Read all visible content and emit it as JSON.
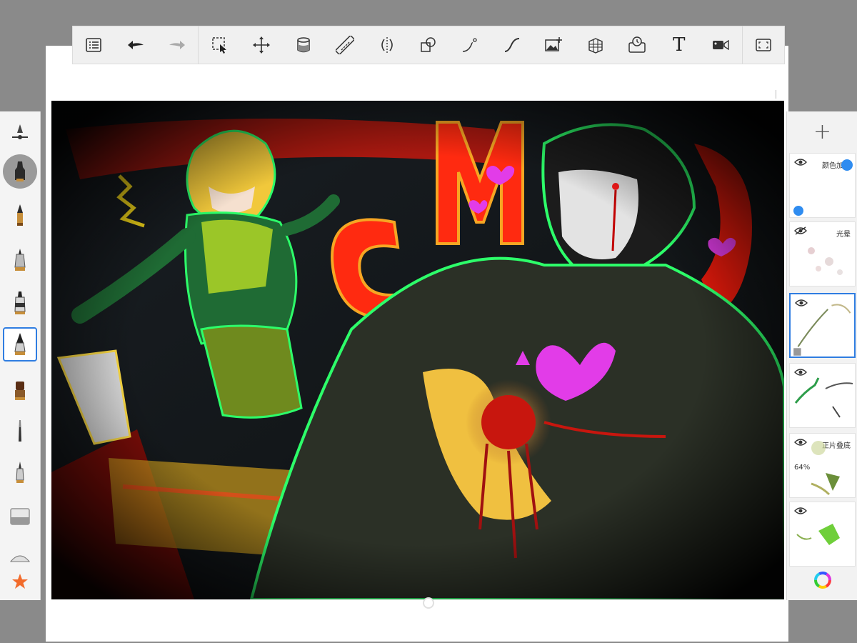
{
  "toolbar": {
    "tools": [
      {
        "name": "list-icon",
        "label": ""
      },
      {
        "name": "undo-icon",
        "label": ""
      },
      {
        "name": "redo-icon",
        "label": ""
      },
      {
        "name": "selection-icon",
        "label": ""
      },
      {
        "name": "transform-icon",
        "label": ""
      },
      {
        "name": "fill-icon",
        "label": ""
      },
      {
        "name": "ruler-icon",
        "label": ""
      },
      {
        "name": "symmetry-icon",
        "label": ""
      },
      {
        "name": "shape-icon",
        "label": ""
      },
      {
        "name": "curve-icon",
        "label": ""
      },
      {
        "name": "stroke-icon",
        "label": ""
      },
      {
        "name": "add-image-icon",
        "label": ""
      },
      {
        "name": "perspective-icon",
        "label": ""
      },
      {
        "name": "time-lapse-icon",
        "label": ""
      },
      {
        "name": "text-icon",
        "label": "T"
      },
      {
        "name": "record-icon",
        "label": ""
      },
      {
        "name": "fullscreen-icon",
        "label": ""
      }
    ]
  },
  "brushes": [
    {
      "name": "brush-settings-icon",
      "selected": false
    },
    {
      "name": "airbrush-icon",
      "selected": "circle"
    },
    {
      "name": "pencil-icon",
      "selected": false
    },
    {
      "name": "ballpoint-icon",
      "selected": false
    },
    {
      "name": "marker-icon",
      "selected": false
    },
    {
      "name": "paintbrush-icon",
      "selected": "box"
    },
    {
      "name": "chisel-brush-icon",
      "selected": false
    },
    {
      "name": "smudge-icon",
      "selected": false
    },
    {
      "name": "fine-tip-icon",
      "selected": false
    },
    {
      "name": "eraser-icon",
      "selected": false
    },
    {
      "name": "soft-eraser-icon",
      "selected": false
    },
    {
      "name": "favorite-star-icon",
      "selected": false
    }
  ],
  "layers": {
    "add_label": "+",
    "items": [
      {
        "name": "颜色加深",
        "opacity": "",
        "visible": true,
        "selected": false
      },
      {
        "name": "光晕",
        "opacity": "",
        "visible": false,
        "selected": false
      },
      {
        "name": "",
        "opacity": "",
        "visible": true,
        "selected": true
      },
      {
        "name": "",
        "opacity": "",
        "visible": true,
        "selected": false
      },
      {
        "name": "正片叠底",
        "opacity": "64%",
        "visible": true,
        "selected": false
      },
      {
        "name": "",
        "opacity": "",
        "visible": true,
        "selected": false
      }
    ]
  },
  "colors": {
    "accent": "#2f7de1",
    "neon_green": "#2dff6a",
    "neon_red": "#ff2a10",
    "neon_pink": "#e23ce8",
    "hair_yellow": "#f1c83b"
  }
}
